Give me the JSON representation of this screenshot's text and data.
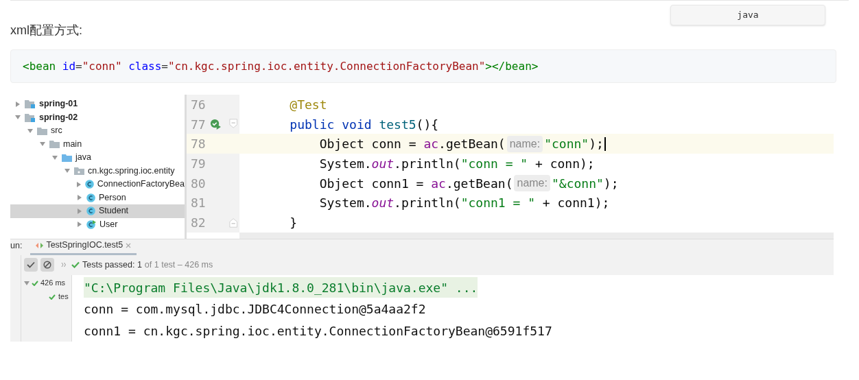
{
  "lang_button": "java",
  "heading": "xml配置方式:",
  "xml_code": [
    {
      "text": "<bean",
      "kind": "tag"
    },
    {
      "text": " id",
      "kind": "attr"
    },
    {
      "text": "=",
      "kind": "plain"
    },
    {
      "text": "\"conn\"",
      "kind": "value"
    },
    {
      "text": " class",
      "kind": "attr"
    },
    {
      "text": "=",
      "kind": "plain"
    },
    {
      "text": "\"cn.kgc.spring.ioc.entity.ConnectionFactoryBean\"",
      "kind": "value"
    },
    {
      "text": "></bean>",
      "kind": "tag"
    }
  ],
  "project_tree": [
    {
      "label": "spring-01",
      "kind": "module",
      "expanded": false,
      "selected": false
    },
    {
      "label": "spring-02",
      "kind": "module",
      "expanded": true,
      "selected": false,
      "children": [
        {
          "label": "src",
          "kind": "folder",
          "expanded": true,
          "selected": false,
          "children": [
            {
              "label": "main",
              "kind": "folder",
              "expanded": true,
              "selected": false,
              "children": [
                {
                  "label": "java",
                  "kind": "source_folder",
                  "expanded": true,
                  "selected": false,
                  "children": [
                    {
                      "label": "cn.kgc.spring.ioc.entity",
                      "kind": "package",
                      "expanded": true,
                      "selected": false,
                      "children": [
                        {
                          "label": "ConnectionFactoryBea",
                          "kind": "class",
                          "expanded": false,
                          "selected": false
                        },
                        {
                          "label": "Person",
                          "kind": "class",
                          "expanded": false,
                          "selected": false
                        },
                        {
                          "label": "Student",
                          "kind": "class",
                          "expanded": false,
                          "selected": true
                        },
                        {
                          "label": "User",
                          "kind": "test_class",
                          "expanded": false,
                          "selected": false
                        }
                      ]
                    }
                  ]
                }
              ]
            }
          ]
        }
      ]
    }
  ],
  "editor_lines": [
    {
      "number": "76",
      "current": false,
      "run_marker": false,
      "fold_start": false,
      "fold_end": false,
      "tokens": [
        {
          "text": "    @Test",
          "kind": "annotation"
        }
      ]
    },
    {
      "number": "77",
      "current": false,
      "run_marker": true,
      "fold_start": true,
      "fold_end": false,
      "tokens": [
        {
          "text": "    public void ",
          "kind": "keyword"
        },
        {
          "text": "test5",
          "kind": "method"
        },
        {
          "text": "(){",
          "kind": "plain"
        }
      ]
    },
    {
      "number": "78",
      "current": true,
      "run_marker": false,
      "fold_start": false,
      "fold_end": false,
      "tokens": [
        {
          "text": "        Object conn = ",
          "kind": "plain"
        },
        {
          "text": "ac",
          "kind": "field"
        },
        {
          "text": ".getBean(",
          "kind": "plain"
        },
        {
          "text": "name:",
          "kind": "hint"
        },
        {
          "text": "\"conn\"",
          "kind": "string"
        },
        {
          "text": ");",
          "kind": "plain"
        }
      ]
    },
    {
      "number": "79",
      "current": false,
      "run_marker": false,
      "fold_start": false,
      "fold_end": false,
      "tokens": [
        {
          "text": "        System.",
          "kind": "plain"
        },
        {
          "text": "out",
          "kind": "static"
        },
        {
          "text": ".println(",
          "kind": "plain"
        },
        {
          "text": "\"conn = \"",
          "kind": "string"
        },
        {
          "text": " + conn);",
          "kind": "plain"
        }
      ]
    },
    {
      "number": "80",
      "current": false,
      "run_marker": false,
      "fold_start": false,
      "fold_end": false,
      "tokens": [
        {
          "text": "        Object conn1 = ",
          "kind": "plain"
        },
        {
          "text": "ac",
          "kind": "field"
        },
        {
          "text": ".getBean(",
          "kind": "plain"
        },
        {
          "text": "name:",
          "kind": "hint"
        },
        {
          "text": "\"&conn\"",
          "kind": "string"
        },
        {
          "text": ");",
          "kind": "plain"
        }
      ]
    },
    {
      "number": "81",
      "current": false,
      "run_marker": false,
      "fold_start": false,
      "fold_end": false,
      "tokens": [
        {
          "text": "        System.",
          "kind": "plain"
        },
        {
          "text": "out",
          "kind": "static"
        },
        {
          "text": ".println(",
          "kind": "plain"
        },
        {
          "text": "\"conn1 = \"",
          "kind": "string"
        },
        {
          "text": " + conn1);",
          "kind": "plain"
        }
      ]
    },
    {
      "number": "82",
      "current": false,
      "run_marker": false,
      "fold_start": false,
      "fold_end": true,
      "tokens": [
        {
          "text": "    }",
          "kind": "plain"
        }
      ]
    }
  ],
  "run_panel": {
    "label": "un:",
    "tab": "TestSpringIOC.test5",
    "status": "Tests passed: 1",
    "status_detail": "of 1 test – 426 ms",
    "test_tree": [
      {
        "label": "426 ms",
        "expanded": true,
        "children": [
          {
            "label": "tes"
          }
        ]
      }
    ],
    "console": [
      {
        "text": "\"C:\\Program Files\\Java\\jdk1.8.0_281\\bin\\java.exe\" ...",
        "kind": "command"
      },
      {
        "text": "conn = com.mysql.jdbc.JDBC4Connection@5a4aa2f2",
        "kind": "output"
      },
      {
        "text": "conn1 = cn.kgc.spring.ioc.entity.ConnectionFactoryBean@6591f517",
        "kind": "output"
      }
    ]
  }
}
